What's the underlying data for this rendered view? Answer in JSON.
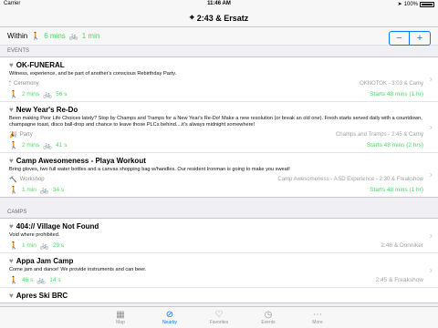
{
  "status": {
    "carrier": "Carrier",
    "time": "11:46 AM",
    "battery": "100%"
  },
  "nav": {
    "title": "2:43 & Ersatz"
  },
  "within": {
    "label": "Within",
    "walk": "6 mins",
    "bike": "1 min",
    "minus": "−",
    "plus": "+"
  },
  "events_header": "EVENTS",
  "events": [
    {
      "title": "OK-FUNERAL",
      "desc": "Witness, experience, and be part of another's conscious Rebirthday Party.",
      "category": "Ceremony",
      "location": "OKNOTOK - 3:03 & Camy",
      "walk": "2 mins",
      "bike": "56 s",
      "starts": "Starts 48 mins (1 hr)"
    },
    {
      "title": "New Year's Re-Do",
      "desc": "Been making Poor Life Choices lately? Stop by Champs and Tramps for a New Year's Re-Do!  Make a new resolution (or break an old one). Fresh starts served daily with a countdown, champagne toast, disco ball-drop and chance to leave those PLCs behind....it's always midnight somewhere!",
      "category": "Party",
      "location": "Champs and Tramps - 2:45 & Carny",
      "walk": "2 mins",
      "bike": "41 s",
      "starts": "Starts 48 mins (2 hrs)"
    },
    {
      "title": "Camp Awesomeness - Playa Workout",
      "desc": "Bring gloves, two full water bottles and a canvas shopping bag w/handles. Our resident Ironman is going to make you sweat!",
      "category": "Workshop",
      "location": "Camp Awesomeness - A 5D Experience - 2:30 & Freakshow",
      "walk": "1 min",
      "bike": "34 s",
      "starts": "Starts 48 mins (1 hr)"
    }
  ],
  "camps_header": "CAMPS",
  "camps": [
    {
      "title": "404:// Village Not Found",
      "desc": "Void where prohibited.",
      "walk": "1 min",
      "bike": "29 s",
      "location": "2:46 & Donniker"
    },
    {
      "title": "Appa Jam Camp",
      "desc": "Come jam and dance! We provide instruments and can beer.",
      "walk": "46 s",
      "bike": "14 s",
      "location": "2:45 & Freakshow"
    },
    {
      "title": "Apres Ski BRC",
      "desc": "",
      "walk": "",
      "bike": "",
      "location": ""
    }
  ],
  "tabs": [
    {
      "label": "Map",
      "icon": "map-icon"
    },
    {
      "label": "Nearby",
      "icon": "compass-icon"
    },
    {
      "label": "Favorites",
      "icon": "heart-icon"
    },
    {
      "label": "Events",
      "icon": "clock-icon"
    },
    {
      "label": "More",
      "icon": "more-icon"
    }
  ]
}
